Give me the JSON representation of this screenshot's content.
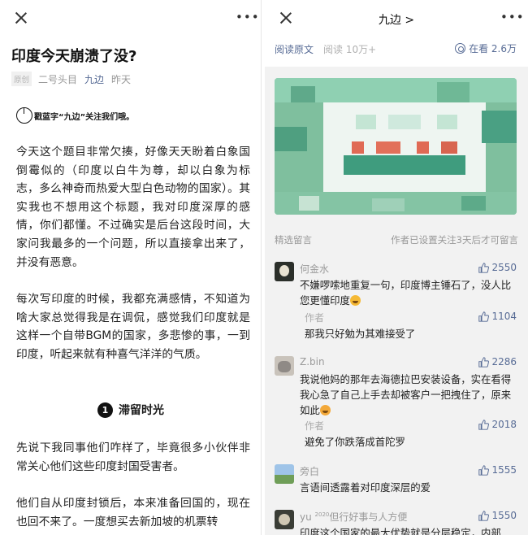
{
  "left": {
    "title": "印度今天崩溃了没?",
    "meta": {
      "original_tag": "原创",
      "author": "二号头目",
      "account": "九边",
      "date": "昨天"
    },
    "follow_prompt": "戳蓝字“九边”关注我们哦。",
    "paragraph1": "今天这个题目非常欠揍，好像天天盼着白象国倒霉似的（印度以白牛为尊，却以白象为标志，多么神奇而热爱大型白色动物的国家）。其实我也不想用这个标题，我对印度深厚的感情，你们都懂。不过确实是后台这段时间，大家问我最多的一个问题，所以直接拿出来了，并没有恶意。",
    "paragraph2": "每次写印度的时候，我都充满感情，不知道为啥大家总觉得我是在调侃，感觉我们印度就是这样一个自带BGM的国家，多悲惨的事，一到印度，听起来就有种喜气洋洋的气质。",
    "section": {
      "number": "1",
      "title": "滞留时光"
    },
    "paragraph3": "先说下我同事他们咋样了，毕竟很多小伙伴非常关心他们这些印度封国受害者。",
    "paragraph4": "他们自从印度封锁后，本来准备回国的，现在也回不来了。一度想买去新加坡的机票转"
  },
  "right": {
    "account_title": "九边 >",
    "read_original": "阅读原文",
    "read_count": "阅读 10万+",
    "watching": "在看 2.6万",
    "comments_label": "精选留言",
    "comments_note": "作者已设置关注3天后才可留言",
    "comments": [
      {
        "name": "何金水",
        "likes": "2550",
        "text": "不嫌啰嗦地重复一句，印度博主锤石了，没人比您更懂印度",
        "reply": {
          "name": "作者",
          "likes": "1104",
          "text": "那我只好勉为其难接受了"
        }
      },
      {
        "name": "Z.bin",
        "likes": "2286",
        "text": "我说他妈的那年去海德拉巴安装设备，实在看得我心急了自己上手去却被客户一把拽住了，原来如此",
        "reply": {
          "name": "作者",
          "likes": "2018",
          "text": "避免了你跌落成首陀罗"
        }
      },
      {
        "name": "旁白",
        "likes": "1555",
        "text": "言语间透露着对印度深层的爱"
      },
      {
        "name": "yu",
        "name_sup": "2020",
        "name_suffix": "但行好事与人方便",
        "likes": "1550",
        "text": "印度这个国家的最大优势就是分层稳定，内部"
      }
    ]
  },
  "icons": {
    "close": "close-icon",
    "more": "more-dots-icon",
    "thumb": "thumb-up-icon",
    "watch": "gear-flower-icon",
    "power": "power-icon"
  },
  "colors": {
    "link": "#576b95",
    "muted": "#999999",
    "background_right": "#f2f2f2"
  }
}
